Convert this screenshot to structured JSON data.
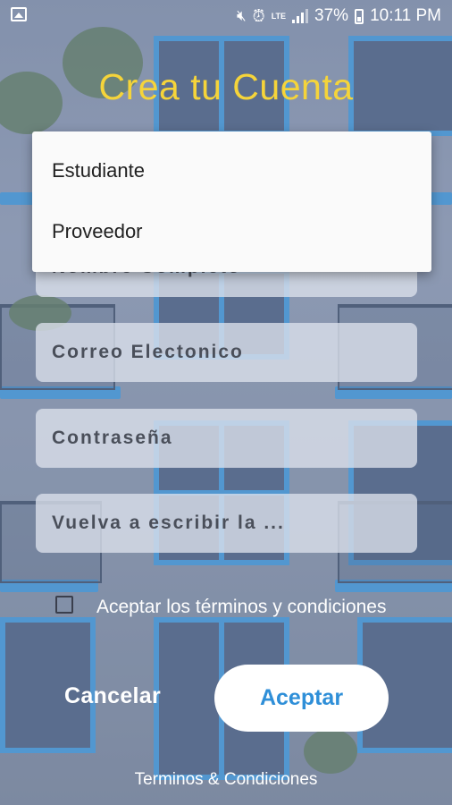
{
  "status_bar": {
    "battery": "37%",
    "time": "10:11 PM",
    "network": "LTE",
    "icons": [
      "image-icon",
      "mute-icon",
      "alarm-icon",
      "signal-icon",
      "battery-icon"
    ]
  },
  "title": "Crea tu Cuenta",
  "dropdown": {
    "options": [
      "Estudiante",
      "Proveedor"
    ]
  },
  "form": {
    "name_placeholder": "Nombre Completo",
    "email_placeholder": "Correo Electonico",
    "password_placeholder": "Contraseña",
    "repeat_placeholder": "Vuelva a escribir la ..."
  },
  "terms_checkbox": {
    "label": "Aceptar los términos y condiciones",
    "checked": false
  },
  "buttons": {
    "cancel": "Cancelar",
    "accept": "Aceptar"
  },
  "footer_link": "Terminos & Condiciones",
  "colors": {
    "title": "#f5d43a",
    "accent": "#2f8fd8"
  }
}
